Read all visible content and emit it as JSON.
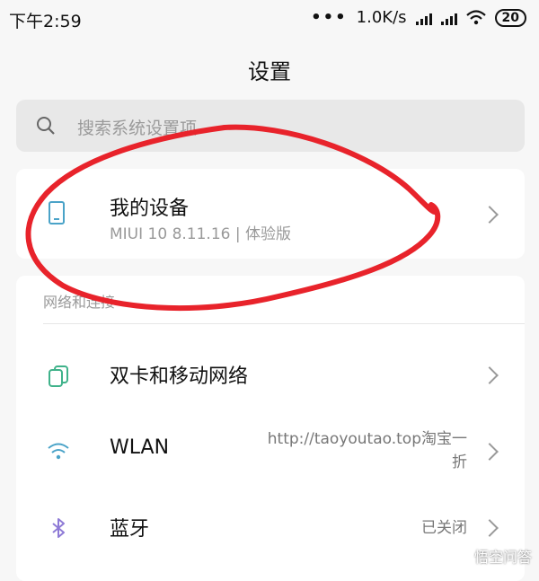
{
  "status_bar": {
    "time": "下午2:59",
    "dots": "•••",
    "net_speed": "1.0K/s",
    "battery": "20"
  },
  "header": {
    "title": "设置"
  },
  "search": {
    "placeholder": "搜索系统设置项"
  },
  "device": {
    "name": "我的设备",
    "subtitle": "MIUI 10 8.11.16 | 体验版"
  },
  "network": {
    "section_label": "网络和连接",
    "items": [
      {
        "label": "双卡和移动网络",
        "icon": "dual-sim-icon",
        "value": ""
      },
      {
        "label": "WLAN",
        "icon": "wifi-icon",
        "value_line1": "http://taoyoutao.top淘宝一",
        "value_line2": "折"
      },
      {
        "label": "蓝牙",
        "icon": "bluetooth-icon",
        "value": "已关闭"
      }
    ]
  },
  "watermark": "悟空问答",
  "colors": {
    "accent": "#4aa3c8",
    "annotation": "#e8232b"
  }
}
